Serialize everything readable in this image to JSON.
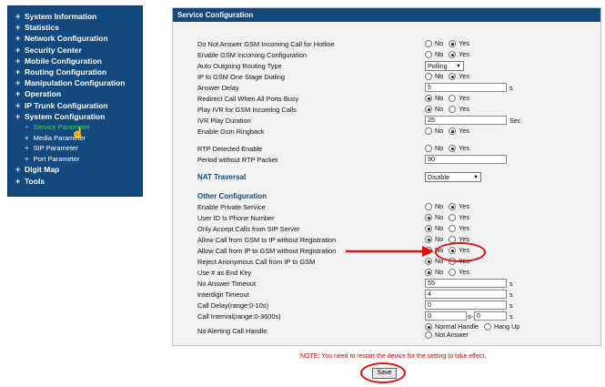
{
  "sidebar": {
    "items": [
      {
        "label": "System Information"
      },
      {
        "label": "Statistics"
      },
      {
        "label": "Network Configuration"
      },
      {
        "label": "Security Center"
      },
      {
        "label": "Mobile Configuration"
      },
      {
        "label": "Routing Configuration"
      },
      {
        "label": "Manipulation Configuration"
      },
      {
        "label": "Operation"
      },
      {
        "label": "IP Trunk Configuration"
      },
      {
        "label": "System Configuration"
      }
    ],
    "sub_items": [
      {
        "label": "Service Parameter"
      },
      {
        "label": "Media Parameter"
      },
      {
        "label": "SIP Parameter"
      },
      {
        "label": "Port Parameter"
      }
    ],
    "bottom_items": [
      {
        "label": "Digit Map"
      },
      {
        "label": "Tools"
      }
    ],
    "bullet": "+",
    "sub_bullet": "+"
  },
  "panel": {
    "title": "Service Configuration"
  },
  "labels": {
    "no": "No",
    "yes": "Yes",
    "s": "s",
    "sec": "Sec",
    "dash": "s-",
    "hang_up": "Hang Up",
    "normal_handle": "Normal Handle",
    "not_answer": "Not Answer"
  },
  "form": {
    "rows1": [
      {
        "label": "Do Not Answer GSM Incoming Call for Hotline",
        "selected": "yes"
      },
      {
        "label": "Enable GSM Incoming Configuration",
        "selected": "yes"
      }
    ],
    "auto_routing": {
      "label": "Auto Outgoing Routing Type",
      "value": "Polling"
    },
    "ip_to_gsm": {
      "label": "IP to GSM One Stage Dialing",
      "selected": "yes"
    },
    "answer_delay": {
      "label": "Answer Delay",
      "value": "5"
    },
    "rows2": [
      {
        "label": "Redirect Call When All Ports Busy",
        "selected": "no"
      },
      {
        "label": "Play IVR for GSM Incoming Calls",
        "selected": "no"
      }
    ],
    "ivr_duration": {
      "label": "IVR Play Duration",
      "value": "25"
    },
    "gsm_ringback": {
      "label": "Enable Gsm Ringback",
      "selected": "yes"
    },
    "rtp_detected": {
      "label": "RTP Detected Enable",
      "selected": "yes"
    },
    "rtp_period": {
      "label": "Period without RTP Packet",
      "value": "90"
    },
    "nat": {
      "label": "NAT Traversal",
      "value": "Disable"
    },
    "other_title": "Other Configuration",
    "rows3": [
      {
        "label": "Enable Private Service",
        "selected": "yes"
      },
      {
        "label": "User ID Is Phone Number",
        "selected": "no"
      },
      {
        "label": "Only Accept Calls from SIP Server",
        "selected": "no"
      },
      {
        "label": "Allow Call from GSM to IP without Registration",
        "selected": "no"
      },
      {
        "label": "Allow Call from IP to GSM without Registration",
        "selected": "yes"
      },
      {
        "label": "Reject Anonymous Call from IP to GSM",
        "selected": "no"
      },
      {
        "label": "Use # as End Key",
        "selected": "no"
      }
    ],
    "no_answer_timeout": {
      "label": "No Answer Timeout",
      "value": "55"
    },
    "interdigit_timeout": {
      "label": "Interdigit Timeout",
      "value": "4"
    },
    "call_delay": {
      "label": "Call Delay(range:0-10s)",
      "value": "0"
    },
    "call_interval": {
      "label": "Call Interval(range:0-3600s)",
      "value_from": "0",
      "value_to": "0"
    },
    "no_alerting": {
      "label": "No Alerting Call Handle",
      "selected": "normal"
    }
  },
  "note": "NOTE: You need to restart the device for the setting to take effect.",
  "save_label": "Save",
  "colors": {
    "nav_bg": "#14497f",
    "active_sub": "#3ddc3d",
    "annotation": "#e01010",
    "note": "#cc0000"
  }
}
